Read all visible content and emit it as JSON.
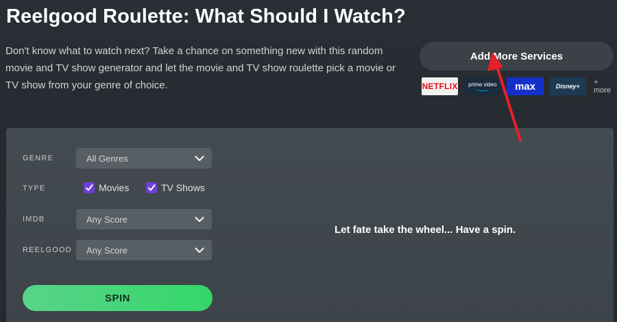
{
  "header": {
    "title": "Reelgood Roulette: What Should I Watch?",
    "description": "Don't know what to watch next? Take a chance on something new with this random movie and TV show generator and let the movie and TV show roulette pick a movie or TV show from your genre of choice."
  },
  "services": {
    "add_button_label": "Add More Services",
    "logos": [
      {
        "name": "NETFLIX"
      },
      {
        "name": "prime video"
      },
      {
        "name": "max"
      },
      {
        "name": "Disney+"
      }
    ],
    "more_label": "+ more"
  },
  "filters": {
    "genre": {
      "label": "GENRE",
      "value": "All Genres"
    },
    "type": {
      "label": "TYPE",
      "options": [
        {
          "label": "Movies",
          "checked": true
        },
        {
          "label": "TV Shows",
          "checked": true
        }
      ]
    },
    "imdb": {
      "label": "IMDB",
      "value": "Any Score"
    },
    "reelgood": {
      "label": "REELGOOD",
      "value": "Any Score"
    }
  },
  "spin_label": "SPIN",
  "result_message": "Let fate take the wheel... Have a spin.",
  "colors": {
    "background": "#262b31",
    "panel": "#40474c",
    "select": "#575e64",
    "checkbox": "#6f3fd6",
    "spin_button": "#3ed873",
    "annotation_arrow": "#e8202a"
  },
  "annotation": {
    "type": "red-arrow",
    "points_to": "Add More Services button"
  }
}
